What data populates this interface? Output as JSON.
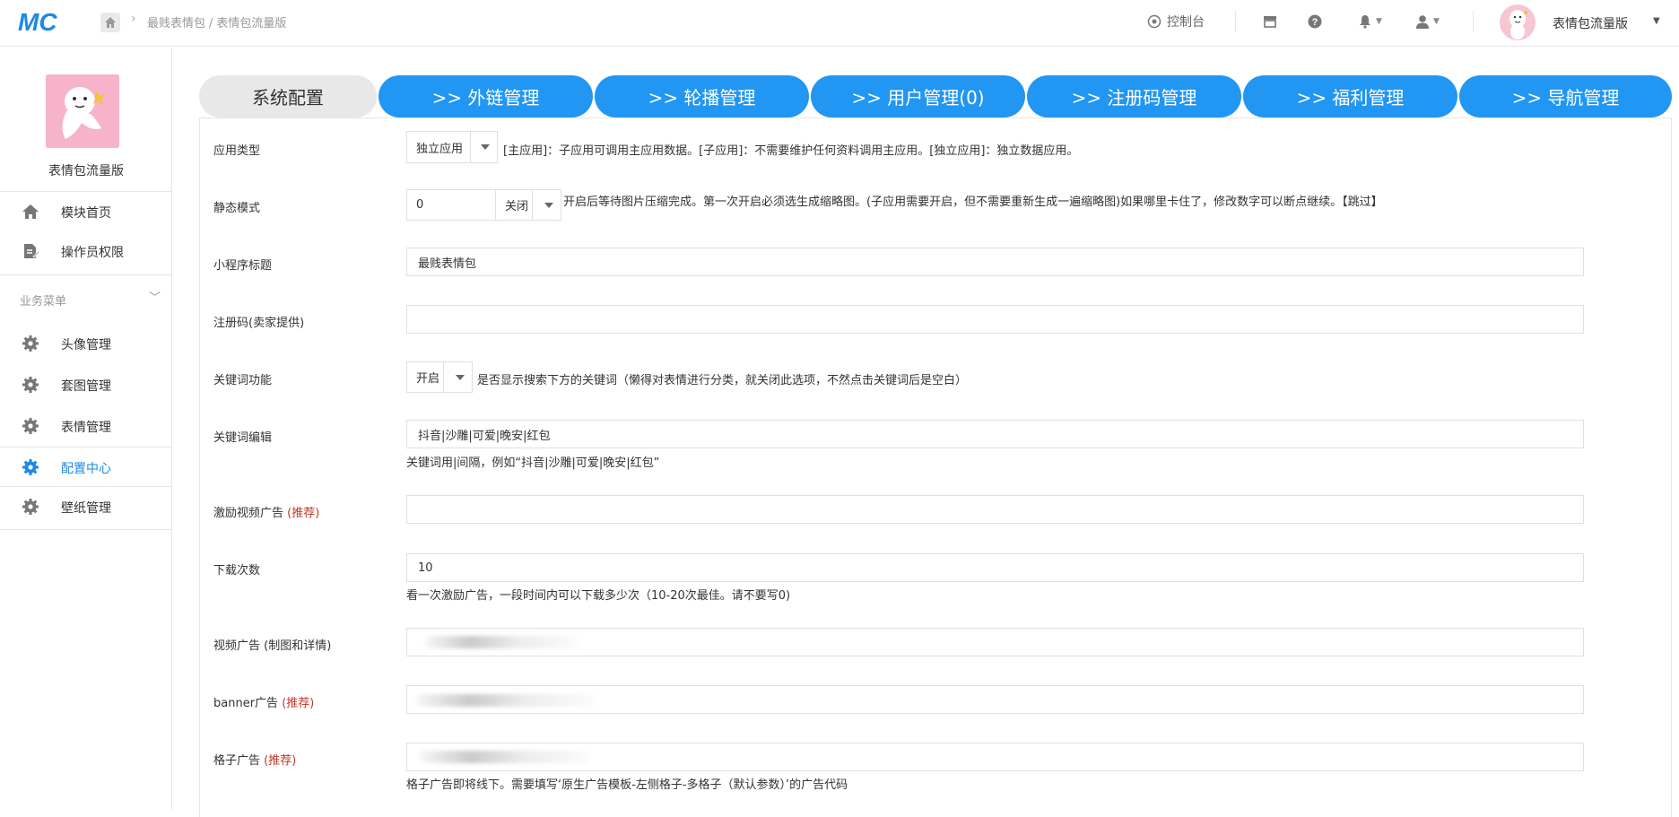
{
  "header": {
    "logo_text": "MC",
    "breadcrumb": [
      "最贱表情包",
      "表情包流量版"
    ],
    "console_label": "控制台",
    "username": "表情包流量版",
    "icons": [
      "home-icon",
      "console-icon",
      "store-icon",
      "help-icon",
      "bell-icon",
      "user-icon"
    ]
  },
  "sidebar": {
    "title": "表情包流量版",
    "top_items": [
      {
        "label": "模块首页",
        "icon": "home-icon"
      },
      {
        "label": "操作员权限",
        "icon": "edit-doc-icon"
      }
    ],
    "group_label": "业务菜单",
    "group_items": [
      {
        "label": "头像管理",
        "icon": "gear-icon"
      },
      {
        "label": "套图管理",
        "icon": "gear-icon"
      },
      {
        "label": "表情管理",
        "icon": "gear-icon"
      },
      {
        "label": "配置中心",
        "icon": "gear-icon",
        "active": true
      },
      {
        "label": "壁纸管理",
        "icon": "gear-icon"
      }
    ]
  },
  "tabs": [
    {
      "label": "系统配置",
      "selected": true
    },
    {
      "label": ">> 外链管理"
    },
    {
      "label": ">> 轮播管理"
    },
    {
      "label": ">> 用户管理(0)"
    },
    {
      "label": ">> 注册码管理"
    },
    {
      "label": ">> 福利管理"
    },
    {
      "label": ">> 导航管理"
    }
  ],
  "form": {
    "app_type": {
      "label": "应用类型",
      "value": "独立应用",
      "help": "[主应用]：子应用可调用主应用数据。[子应用]：不需要维护任何资料调用主应用。[独立应用]：独立数据应用。"
    },
    "static_mode": {
      "label": "静态模式",
      "value": "0",
      "toggle": "关闭",
      "help": "开启后等待图片压缩完成。第一次开启必须选生成缩略图。(子应用需要开启，但不需要重新生成一遍缩略图)如果哪里卡住了，修改数字可以断点继续。【跳过】"
    },
    "mini_title": {
      "label": "小程序标题",
      "value": "最贱表情包"
    },
    "reg_code": {
      "label": "注册码(卖家提供)",
      "value": ""
    },
    "keyword_func": {
      "label": "关键词功能",
      "value": "开启",
      "help": "是否显示搜索下方的关键词（懒得对表情进行分类，就关闭此选项，不然点击关键词后是空白）"
    },
    "keyword_edit": {
      "label": "关键词编辑",
      "value": "抖音|沙雕|可爱|晚安|红包",
      "help": "关键词用|间隔，例如“抖音|沙雕|可爱|晚安|红包”"
    },
    "reward_ad": {
      "label": "激励视频广告",
      "tag": "(推荐)",
      "value": ""
    },
    "download_count": {
      "label": "下载次数",
      "value": "10",
      "help": "看一次激励广告，一段时间内可以下载多少次（10-20次最佳。请不要写0)"
    },
    "video_ad": {
      "label": "视频广告 (制图和详情)"
    },
    "banner_ad": {
      "label": "banner广告",
      "tag": "(推荐)"
    },
    "grid_ad": {
      "label": "格子广告",
      "tag": "(推荐)",
      "help": "格子广告即将线下。需要填写‘原生广告模板-左侧格子-多格子（默认参数）’的广告代码"
    }
  },
  "colors": {
    "accent": "#2196f3",
    "active_text": "#1e88e5",
    "recommend": "#c0392b"
  }
}
